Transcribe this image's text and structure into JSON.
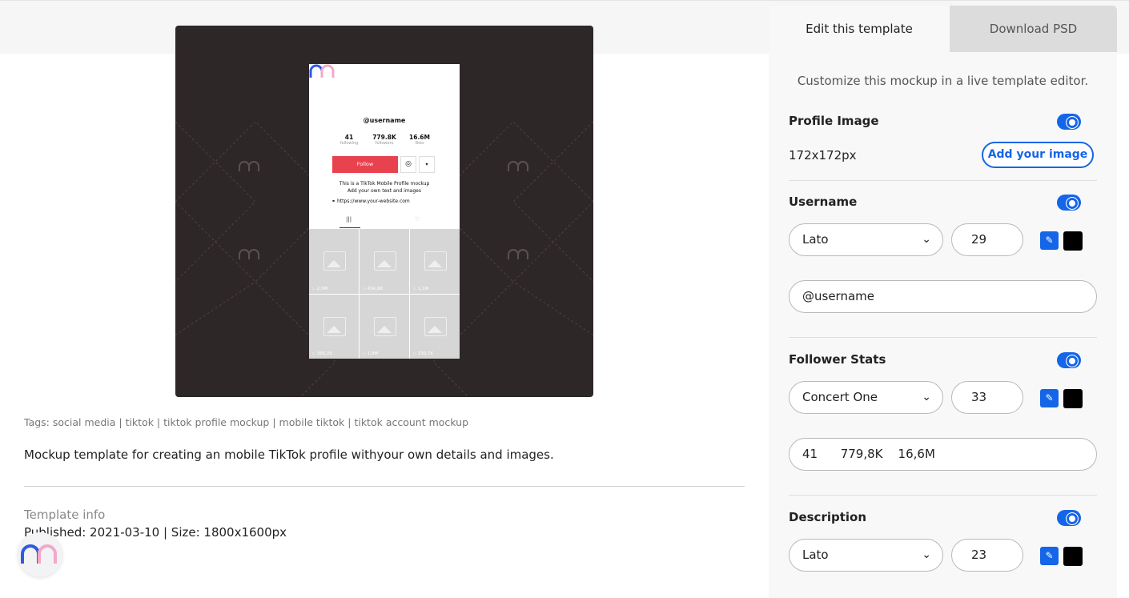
{
  "preview": {
    "phone": {
      "username": "@username",
      "stats": [
        {
          "value": "41",
          "label": "following"
        },
        {
          "value": "779.8K",
          "label": "followers"
        },
        {
          "value": "16.6M",
          "label": "likes"
        }
      ],
      "follow_label": "Follow",
      "instagram_icon": "◎",
      "dropdown_icon": "▾",
      "description_line1": "This is a TikTok Mobile Profile mockup",
      "description_line2": "Add your own text and images",
      "link": "https://www.your-website.com",
      "tab_grid_icon": "|||",
      "tab_heart_icon": "♡",
      "video_counts": [
        "2,5M",
        "456,8K",
        "1,1M",
        "305,2K",
        "1,9M",
        "230,7K"
      ]
    }
  },
  "tags": "Tags: social media | tiktok | tiktok profile mockup | mobile tiktok | tiktok account mockup",
  "blurb": "Mockup template for creating an mobile TikTok profile withyour own details and images.",
  "info": {
    "title": "Template info",
    "line": "Published: 2021-03-10 | Size: 1800x1600px"
  },
  "panel": {
    "tabs": {
      "edit": "Edit this template",
      "download": "Download PSD"
    },
    "intro": "Customize this mockup in a live template editor.",
    "profile_image": {
      "label": "Profile Image",
      "size": "172x172px",
      "button": "Add your image"
    },
    "username": {
      "label": "Username",
      "font": "Lato",
      "size": "29",
      "text": "@username"
    },
    "follower_stats": {
      "label": "Follower Stats",
      "font": "Concert One",
      "size": "33",
      "text": "41      779,8K    16,6M"
    },
    "description": {
      "label": "Description",
      "font": "Lato",
      "size": "23"
    },
    "chevron_icon": "⌄",
    "picker_icon": "✎"
  },
  "colors": {
    "accent": "#1565e8",
    "follow": "#e8424f",
    "preview_bg": "#2e2728"
  }
}
